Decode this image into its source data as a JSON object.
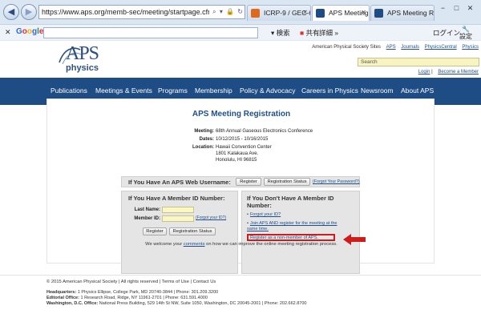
{
  "browser": {
    "url": "https://www.aps.org/memb-sec/meeting/startpage.cfm?even",
    "tabs": [
      {
        "label": "ICRP-9 / GEC-68 ...",
        "active": false,
        "favicon_color": "#e06a1b"
      },
      {
        "label": "APS Meeting R...",
        "active": true,
        "favicon_color": "#1e4c85"
      },
      {
        "label": "APS Meeting Regi...",
        "active": false,
        "favicon_color": "#1e4c85"
      }
    ],
    "window_buttons": [
      "−",
      "□",
      "✕"
    ],
    "toolbar": {
      "google": "Google",
      "search_label": "検索",
      "share_label": "共有",
      "detail_label": "詳細 »",
      "login_label": "ログイン",
      "settings_label": "設定"
    }
  },
  "header": {
    "logo_aps": "APS",
    "logo_physics": "physics",
    "top_links_text": "American Physical Society Sites",
    "top_links": [
      "APS",
      "Journals",
      "PhysicsCentral",
      "Physics"
    ],
    "search_placeholder": "Search",
    "login_link": "Login",
    "become_member_link": "Become a Member"
  },
  "nav": [
    "Publications",
    "Meetings & Events",
    "Programs",
    "Membership",
    "Policy & Advocacy",
    "Careers in Physics",
    "Newsroom",
    "About APS"
  ],
  "registration": {
    "title": "APS Meeting Registration",
    "meeting_label": "Meeting:",
    "meeting_value": "68th Annual Gaseous Electronics Conference",
    "dates_label": "Dates:",
    "dates_value": "10/12/2015 - 10/16/2015",
    "location_label": "Location:",
    "location_lines": [
      "Hawaii Convention Center",
      "1801 Kalakaua Ave.",
      "Honolulu, HI 96815"
    ],
    "web_username_label": "If You Have An APS Web Username:",
    "register_btn": "Register",
    "registration_status_btn": "Registration Status",
    "forgot_password": "(Forgot Your Password?)",
    "left_panel_title": "If You Have A Member ID Number:",
    "last_name_label": "Last Name:",
    "member_id_label": "Member ID:",
    "forgot_id_small": "(Forgot your ID?)",
    "right_panel_title": "If You Don't Have A Member ID Number:",
    "right_links": [
      "Forgot your ID?",
      "Join APS AND register for the meeting at the same time.",
      "Register as a non-member of APS."
    ],
    "welcome_pre": "We welcome your ",
    "welcome_link": "comments",
    "welcome_post": " on how we can improve the online meeting registration process."
  },
  "footer": {
    "links_line": "© 2015 American Physical Society | All rights reserved | Terms of Use | Contact Us",
    "hq_label": "Headquarters:",
    "hq_value": "1 Physics Ellipse, College Park, MD 20740-3844 | Phone: 301.209.3200",
    "editorial_label": "Editorial Office:",
    "editorial_value": "1 Research Road, Ridge, NY 11961-2701 | Phone: 631.591.4000",
    "dc_label": "Washington, D.C. Office:",
    "dc_value": "National Press Building, 529 14th St NW, Suite 1050, Washington, DC 20045-2001 | Phone: 202.662.8700"
  },
  "colors": {
    "nav_bg": "#1e4c85",
    "link": "#1f4f8e",
    "highlight": "#d11b1b",
    "input_yellow": "#fbf7c4"
  }
}
